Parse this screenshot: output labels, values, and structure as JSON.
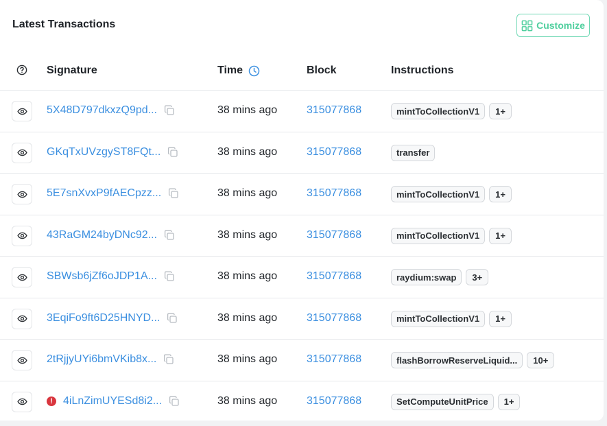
{
  "header": {
    "title": "Latest Transactions",
    "customize_label": "Customize"
  },
  "columns": {
    "signature": "Signature",
    "time": "Time",
    "block": "Block",
    "instructions": "Instructions"
  },
  "colors": {
    "link": "#3b8fe0",
    "accent": "#4fcf9e",
    "error": "#d9363e"
  },
  "rows": [
    {
      "signature": "5X48D797dkxzQ9pd...",
      "time": "38 mins ago",
      "block": "315077868",
      "instruction": "mintToCollectionV1",
      "more": "1+",
      "error": false
    },
    {
      "signature": "GKqTxUVzgyST8FQt...",
      "time": "38 mins ago",
      "block": "315077868",
      "instruction": "transfer",
      "more": "",
      "error": false
    },
    {
      "signature": "5E7snXvxP9fAECpzz...",
      "time": "38 mins ago",
      "block": "315077868",
      "instruction": "mintToCollectionV1",
      "more": "1+",
      "error": false
    },
    {
      "signature": "43RaGM24byDNc92...",
      "time": "38 mins ago",
      "block": "315077868",
      "instruction": "mintToCollectionV1",
      "more": "1+",
      "error": false
    },
    {
      "signature": "SBWsb6jZf6oJDP1A...",
      "time": "38 mins ago",
      "block": "315077868",
      "instruction": "raydium:swap",
      "more": "3+",
      "error": false
    },
    {
      "signature": "3EqiFo9ft6D25HNYD...",
      "time": "38 mins ago",
      "block": "315077868",
      "instruction": "mintToCollectionV1",
      "more": "1+",
      "error": false
    },
    {
      "signature": "2tRjjyUYi6bmVKib8x...",
      "time": "38 mins ago",
      "block": "315077868",
      "instruction": "flashBorrowReserveLiquid...",
      "more": "10+",
      "error": false
    },
    {
      "signature": "4iLnZimUYESd8i2...",
      "time": "38 mins ago",
      "block": "315077868",
      "instruction": "SetComputeUnitPrice",
      "more": "1+",
      "error": true
    }
  ]
}
